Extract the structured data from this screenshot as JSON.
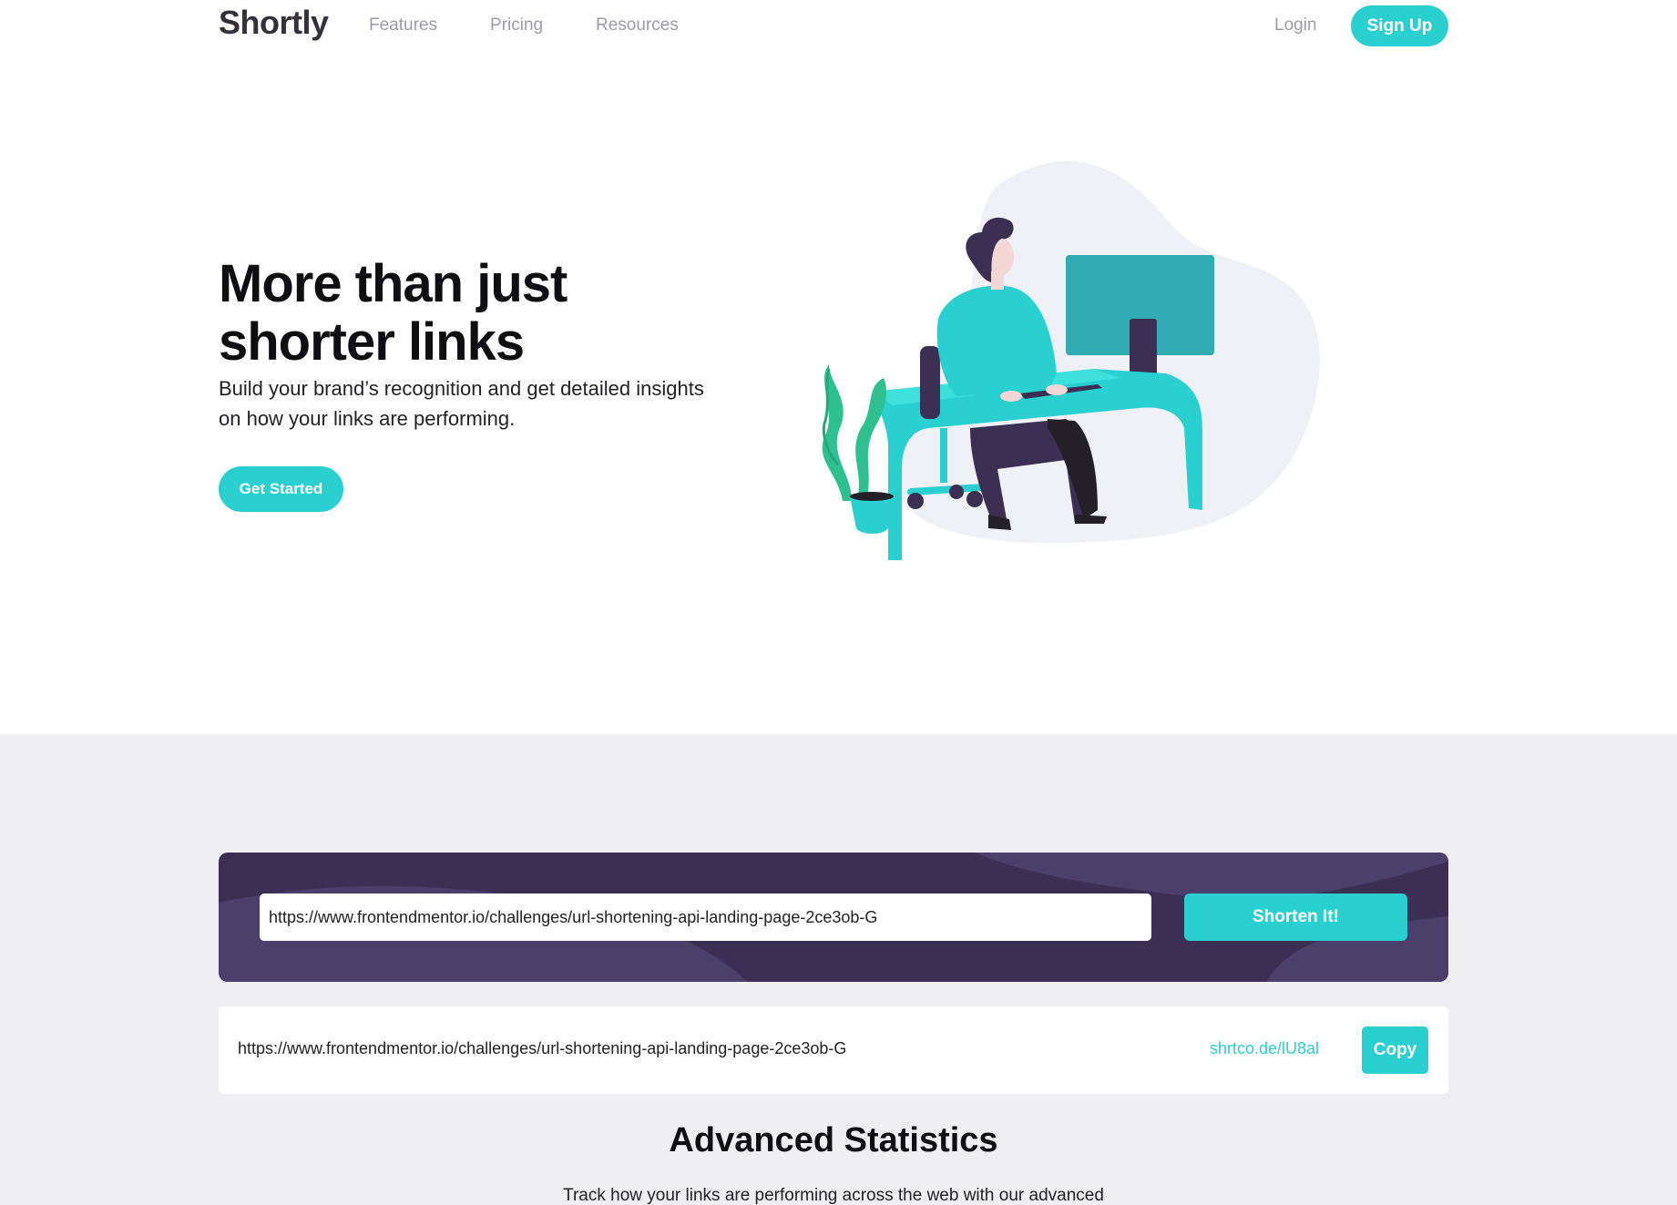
{
  "header": {
    "logo": "Shortly",
    "nav": {
      "features": "Features",
      "pricing": "Pricing",
      "resources": "Resources"
    },
    "login": "Login",
    "signup": "Sign Up"
  },
  "hero": {
    "title": "More than just shorter links",
    "subtitle": "Build your brand’s recognition and get detailed insights on how your links are performing.",
    "cta": "Get Started"
  },
  "shortener": {
    "input_value": "https://www.frontendmentor.io/challenges/url-shortening-api-landing-page-2ce3ob-G",
    "button": "Shorten It!"
  },
  "results": [
    {
      "original": "https://www.frontendmentor.io/challenges/url-shortening-api-landing-page-2ce3ob-G",
      "short": "shrtco.de/lU8al",
      "copy": "Copy"
    }
  ],
  "statistics": {
    "title": "Advanced Statistics",
    "subtitle": "Track how your links are performing across the web with our advanced"
  },
  "colors": {
    "accent": "#2acfcf",
    "dark_violet": "#3b3054",
    "gray_bg": "#efeff1",
    "grayish_violet": "#9e9aa8"
  }
}
